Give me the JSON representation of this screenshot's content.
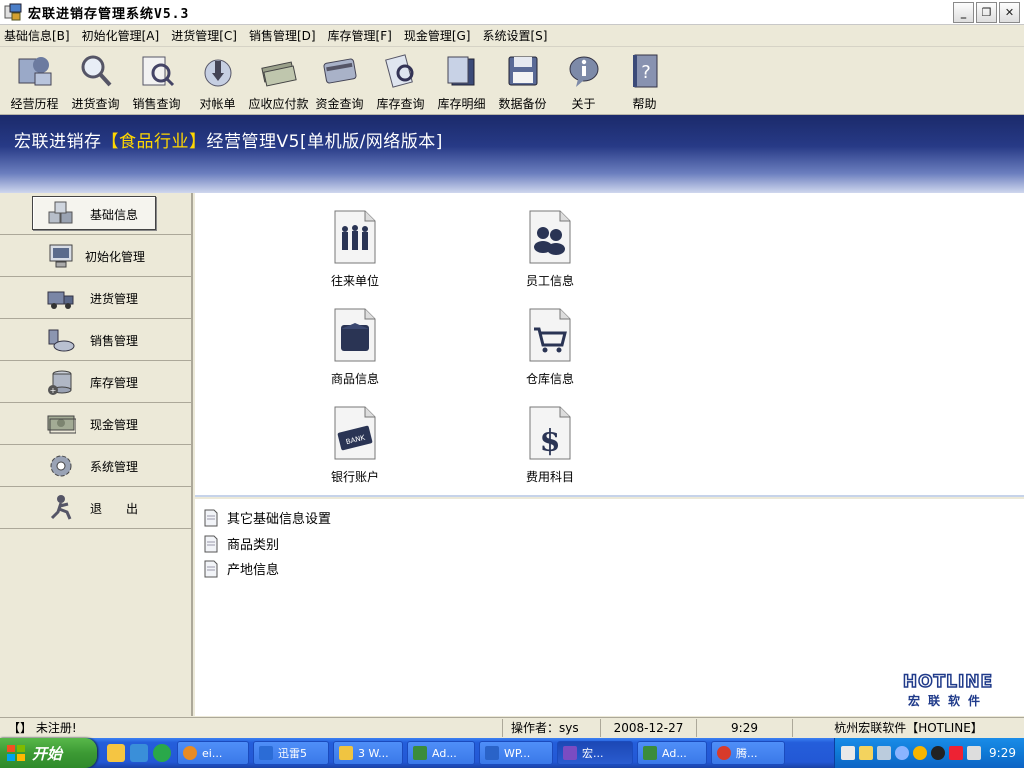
{
  "window": {
    "title": "宏联进销存管理系统V5.3"
  },
  "menu": [
    "基础信息[B]",
    "初始化管理[A]",
    "进货管理[C]",
    "销售管理[D]",
    "库存管理[F]",
    "现金管理[G]",
    "系统设置[S]"
  ],
  "toolbar": [
    {
      "label": "经营历程",
      "icon": "business-history-icon"
    },
    {
      "label": "进货查询",
      "icon": "magnifier-icon"
    },
    {
      "label": "销售查询",
      "icon": "sales-query-icon"
    },
    {
      "label": "对帐单",
      "icon": "statement-icon"
    },
    {
      "label": "应收应付款",
      "icon": "cash-stack-icon"
    },
    {
      "label": "资金查询",
      "icon": "card-icon"
    },
    {
      "label": "库存查询",
      "icon": "inventory-query-icon"
    },
    {
      "label": "库存明细",
      "icon": "inventory-detail-icon"
    },
    {
      "label": "数据备份",
      "icon": "floppy-icon"
    },
    {
      "label": "关于",
      "icon": "info-icon"
    },
    {
      "label": "帮助",
      "icon": "help-book-icon"
    }
  ],
  "banner": {
    "prefix": "宏联进销存",
    "highlight": "【食品行业】",
    "suffix": "经营管理V5[单机版/网络版本]"
  },
  "nav": [
    {
      "label": "基础信息",
      "icon": "cubes-icon",
      "active": true
    },
    {
      "label": "初始化管理",
      "icon": "monitor-icon",
      "active": false
    },
    {
      "label": "进货管理",
      "icon": "truck-icon",
      "active": false
    },
    {
      "label": "销售管理",
      "icon": "handshake-icon",
      "active": false
    },
    {
      "label": "库存管理",
      "icon": "database-icon",
      "active": false
    },
    {
      "label": "现金管理",
      "icon": "money-icon",
      "active": false
    },
    {
      "label": "系统管理",
      "icon": "settings-gear-icon",
      "active": false
    },
    {
      "label": "退　　出",
      "icon": "exit-runner-icon",
      "active": false
    }
  ],
  "tiles": [
    {
      "label": "往来单位",
      "icon": "partners-icon"
    },
    {
      "label": "员工信息",
      "icon": "employees-icon"
    },
    {
      "label": "商品信息",
      "icon": "product-box-icon"
    },
    {
      "label": "仓库信息",
      "icon": "shopping-cart-icon"
    },
    {
      "label": "银行账户",
      "icon": "bank-card-icon"
    },
    {
      "label": "费用科目",
      "icon": "dollar-icon"
    }
  ],
  "links": [
    "其它基础信息设置",
    "商品类别",
    "产地信息"
  ],
  "logo": {
    "text": "HOTLINE",
    "subtext": "宏联软件"
  },
  "status": {
    "register": "【】 未注册!",
    "operator": "操作者：sys",
    "date": "2008-12-27",
    "time": "9:29",
    "company": "杭州宏联软件【HOTLINE】"
  },
  "taskbar": {
    "start_label": "开始",
    "tasks": [
      {
        "label": "ei...",
        "color": "#e88b24"
      },
      {
        "label": "迅雷5",
        "color": "#2b6cd6"
      },
      {
        "label": "3 W...",
        "color": "#f0c441"
      },
      {
        "label": "Ad...",
        "color": "#3b8c3b"
      },
      {
        "label": "WP...",
        "color": "#2a63c8"
      },
      {
        "label": "宏...",
        "color": "#7a4cc2"
      },
      {
        "label": "Ad...",
        "color": "#3b8c3b"
      },
      {
        "label": "腾...",
        "color": "#d83b2b"
      }
    ],
    "clock": "9:29"
  },
  "colors": {
    "banner_highlight": "#ffd700",
    "accent": "#245edb"
  }
}
